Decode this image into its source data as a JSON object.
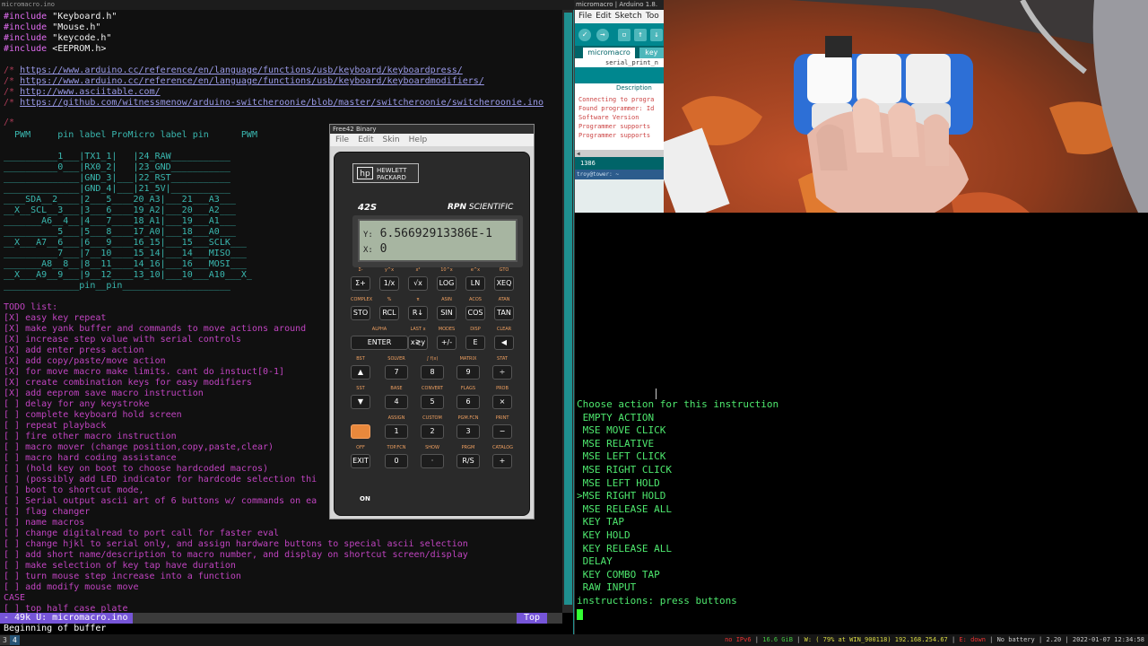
{
  "window_title": "micromacro.ino",
  "editor": {
    "includes": [
      {
        "kw": "#include",
        "file": "\"Keyboard.h\""
      },
      {
        "kw": "#include",
        "file": "\"Mouse.h\""
      },
      {
        "kw": "#include",
        "file": "\"keycode.h\""
      },
      {
        "kw": "#include",
        "file": "<EEPROM.h>"
      }
    ],
    "urls": [
      "https://www.arduino.cc/reference/en/language/functions/usb/keyboard/keyboardpress/",
      "https://www.arduino.cc/reference/en/language/functions/usb/keyboard/keyboardmodifiers/",
      "http://www.asciitable.com/",
      "https://github.com/witnessmenow/arduino-switcheroonie/blob/master/switcheroonie/switcheroonie.ino"
    ],
    "comment_marker": "/*",
    "table_header": "  PWM     pin label ProMicro label pin      PWM",
    "table_rows": [
      "__________1___|TX1_1|   |24_RAW___________",
      "__________0___|RX0_2|   |23_GND___________",
      "______________|GND_3|___|22_RST___________",
      "______________|GND_4|___|21_5V|___________",
      "____SDA__2____|2___5____20_A3|___21___A3___",
      "__X__SCL__3___|3___6____19_A2|___20___A2___",
      "_______A6__4__|4___7____18_A1|___19___A1___",
      "__________5___|5___8____17_A0|___18___A0___",
      "__X___A7__6___|6___9____16_15|___15___SCLK___",
      "__________7___|7__10____15_14|___14___MISO___",
      "_______A8__8__|8__11____14_16|___16___MOSI___",
      "__X___A9__9___|9__12____13_10|___10___A10___X_",
      "______________pin__pin____________________"
    ],
    "todo_lines": [
      "TODO list:",
      "[X] easy key repeat",
      "[X] make yank buffer and commands to move actions around",
      "[X] increase step value with serial controls",
      "[X] add enter press action",
      "[X] add copy/paste/move action",
      "[X] for move macro make limits. cant do instuct[0-1]",
      "[X] create combination keys for easy modifiers",
      "[X] add eeprom save macro instruction",
      "[ ] delay for any keystroke",
      "[ ] complete keyboard hold screen",
      "[ ] repeat playback",
      "[ ] fire other macro instruction",
      "[ ] macro mover (change position,copy,paste,clear)",
      "[ ] macro hard coding assistance",
      "[ ] (hold key on boot to choose hardcoded macros)",
      "[ ] (possibly add LED indicator for hardcode selection thi",
      "[ ] boot to shortcut mode,",
      "[ ] Serial output ascii art of 6 buttons w/ commands on ea",
      "[ ] flag changer",
      "[ ] name macros",
      "[ ] change digitalread to port call for faster eval",
      "[ ] change hjkl to serial only, and assign hardware buttons to special ascii selection",
      "[ ] add short name/description to macro number, and display on shortcut screen/display",
      "[ ] make selection of key tap have duration",
      "[ ] turn mouse step increase into a function",
      "[ ] add modify mouse move",
      "CASE",
      "[ ] top half case plate"
    ]
  },
  "modeline": {
    "buffer": "- 49k U:  micromacro.ino",
    "position": "Top"
  },
  "echo_area": "Beginning of buffer",
  "calculator": {
    "title": "Free42 Binary",
    "menu": [
      "File",
      "Edit",
      "Skin",
      "Help"
    ],
    "brand_line1": "HEWLETT",
    "brand_line2": "PACKARD",
    "brand_mark": "hp",
    "model": "42S",
    "rpn_bold": "RPN",
    "rpn_rest": " SCIENTIFIC",
    "display_y_label": "Y:",
    "display_y": "6.56692913386E-1",
    "display_x_label": "X:",
    "display_x": "0",
    "on_label": "ON"
  },
  "arduino": {
    "title": "micromacro | Arduino 1.8.",
    "menu": [
      "File",
      "Edit",
      "Sketch",
      "Too"
    ],
    "tab": "micromacro",
    "tab2": "key",
    "code_line": "serial_print_n",
    "description": "Description",
    "console": [
      "Connecting to progra",
      "Found programmer: Id",
      "    Software Version",
      "Programmer supports",
      "Programmer supports"
    ],
    "line_number": "1386",
    "terminal_title": "troy@tower: ~"
  },
  "terminal": {
    "lines": [
      "Choose action for this instruction",
      " EMPTY ACTION",
      " MSE MOVE CLICK",
      " MSE RELATIVE",
      " MSE LEFT CLICK",
      " MSE RIGHT CLICK",
      " MSE LEFT HOLD",
      ">MSE RIGHT HOLD",
      " MSE RELEASE ALL",
      " KEY TAP",
      " KEY HOLD",
      " KEY RELEASE ALL",
      " DELAY",
      " KEY COMBO TAP",
      " RAW INPUT",
      "instructions: press buttons"
    ]
  },
  "statusbar": {
    "workspaces": [
      "3",
      "4"
    ],
    "ipv6": "no IPv6",
    "disk": "16.6 GiB",
    "wifi": "W: ( 79% at WIN_900118) 192.168.254.67",
    "eth": "E: down",
    "battery": "No battery",
    "load": "2.20",
    "datetime": "2022-01-07 12:34:58"
  },
  "colors": {
    "terminal_text": "#4ee86e",
    "modeline_accent": "#7655d8",
    "arduino_teal": "#00878f"
  }
}
